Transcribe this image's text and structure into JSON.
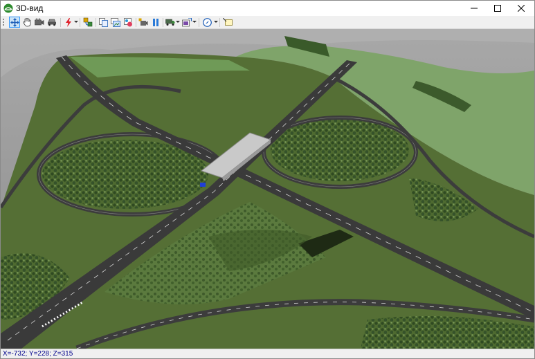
{
  "window": {
    "title": "3D-вид",
    "controls": [
      "minimize-icon",
      "maximize-icon",
      "close-icon"
    ]
  },
  "toolbar": {
    "buttons": [
      {
        "icon": "pan-arrows-icon",
        "active": true
      },
      {
        "icon": "hand-icon"
      },
      {
        "icon": "camera-icon"
      },
      {
        "icon": "car-icon"
      },
      {
        "icon": "lightning-icon",
        "dropdown": true
      },
      {
        "icon": "route-icon"
      },
      {
        "icon": "copy-view-icon"
      },
      {
        "icon": "screenshot-icon"
      },
      {
        "icon": "palette-icon"
      },
      {
        "icon": "record-icon"
      },
      {
        "icon": "pause-icon"
      },
      {
        "icon": "truck-icon",
        "dropdown": true
      },
      {
        "icon": "export-icon",
        "dropdown": true
      },
      {
        "icon": "compass-icon",
        "dropdown": true
      },
      {
        "icon": "comment-icon"
      }
    ]
  },
  "status": {
    "coords": "X=-732; Y=228; Z=315"
  },
  "colors": {
    "terrain_dark": "#4f6a2e",
    "terrain_light": "#6f9a57",
    "road": "#3c3c3c",
    "sky_fog": "#9a9a9a",
    "accent": "#3399ff"
  }
}
